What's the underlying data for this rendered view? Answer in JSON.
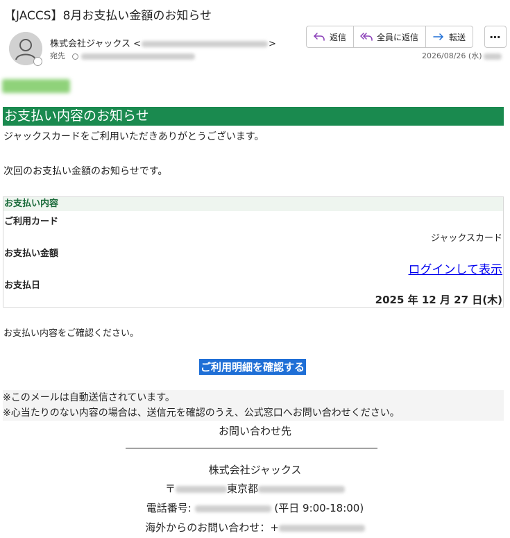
{
  "email": {
    "subject": "【JACCS】8月お支払い金額のお知らせ",
    "sender_name": "株式会社ジャックス <",
    "sender_close": ">",
    "to_label": "宛先",
    "date": "2026/08/26 (水)"
  },
  "toolbar": {
    "reply_label": "返信",
    "reply_all_label": "全員に返信",
    "forward_label": "転送",
    "more_label": "⋯"
  },
  "body": {
    "banner_title": "お支払い内容のお知らせ",
    "greeting": "ジャックスカードをご利用いただきありがとうございます。",
    "intro": "次回のお支払い金額のお知らせです。",
    "info_header": "お支払い内容",
    "card_label": "ご利用カード",
    "card_value": "ジャックスカード",
    "amount_label": "お支払い金額",
    "amount_link": "ログインして表示",
    "pay_date_label": "お支払日",
    "pay_date_value": "2025 年 12 月 27 日(木)",
    "confirm_text": "お支払い内容をご確認ください。",
    "cta_label": "ご利用明細を確認する",
    "notice_1": "※このメールは自動送信されています。",
    "notice_2": "※心当たりのない内容の場合は、送信元を確認のうえ、公式窓口へお問い合わせください。"
  },
  "footer": {
    "contact_title": "お問い合わせ先",
    "company": "株式会社ジャックス",
    "postal_prefix": "〒",
    "address_prefix": "東京都",
    "phone_label": "電話番号:",
    "hours": "(平日 9:00-18:00)",
    "overseas_label": "海外からのお問い合わせ：+"
  },
  "colors": {
    "banner_green": "#1a8a4f",
    "info_header_bg": "#eef5ef",
    "cta_blue": "#1f6fd6",
    "link_blue": "#0000ee",
    "reply_icon": "#8a3fb8",
    "forward_icon": "#1f6fd6"
  },
  "icons": {
    "avatar": "person-icon",
    "reply": "reply-arrow-icon",
    "reply_all": "reply-all-arrow-icon",
    "forward": "forward-arrow-icon",
    "more": "more-horizontal-icon"
  }
}
